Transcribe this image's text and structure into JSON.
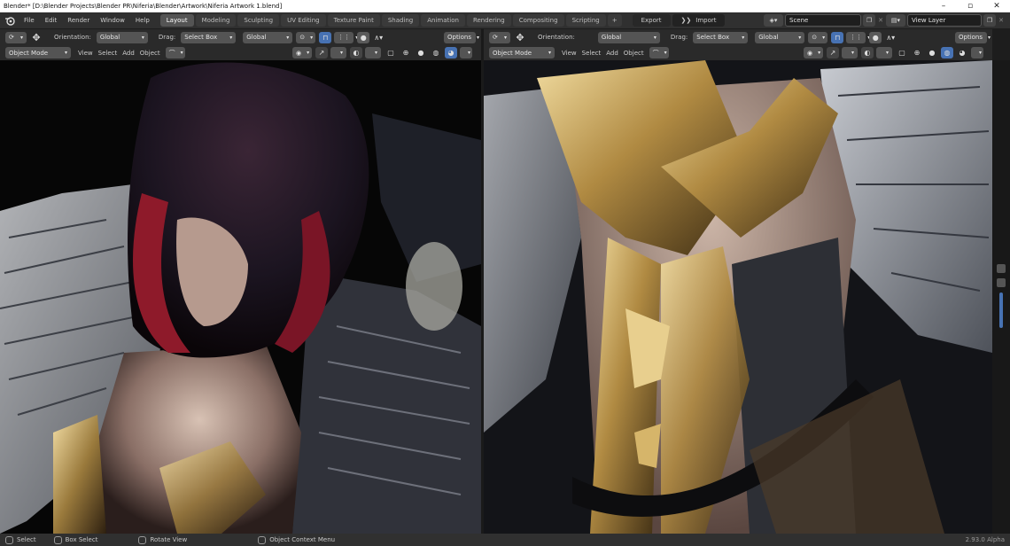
{
  "window": {
    "title": "Blender* [D:\\Blender Projects\\Blender PR\\Niferia\\Blender\\Artwork\\Niferia Artwork 1.blend]",
    "minimize": "–",
    "maximize": "▫",
    "close": "✕"
  },
  "menu": [
    "File",
    "Edit",
    "Render",
    "Window",
    "Help"
  ],
  "workspace_tabs": [
    {
      "label": "Layout",
      "active": true
    },
    {
      "label": "Modeling"
    },
    {
      "label": "Sculpting"
    },
    {
      "label": "UV Editing"
    },
    {
      "label": "Texture Paint"
    },
    {
      "label": "Shading"
    },
    {
      "label": "Animation"
    },
    {
      "label": "Rendering"
    },
    {
      "label": "Compositing"
    },
    {
      "label": "Scripting"
    }
  ],
  "add_tab": "+",
  "export_label": "Export",
  "import_label": "Import",
  "scene": {
    "value": "Scene"
  },
  "view_layer": {
    "value": "View Layer"
  },
  "left_header": {
    "orientation_label": "Orientation:",
    "orientation_value": "Global",
    "drag_label": "Drag:",
    "drag_value": "Select Box",
    "pivot_value": "Global",
    "options_label": "Options"
  },
  "right_header": {
    "orientation_label": "Orientation:",
    "orientation_value": "Global",
    "drag_label": "Drag:",
    "drag_value": "Select Box",
    "pivot_value": "Global",
    "options_label": "Options"
  },
  "left_mode": {
    "mode": "Object Mode",
    "view": "View",
    "select": "Select",
    "add": "Add",
    "object": "Object"
  },
  "right_mode": {
    "mode": "Object Mode",
    "view": "View",
    "select": "Select",
    "add": "Add",
    "object": "Object"
  },
  "status": {
    "select": "Select",
    "box_select": "Box Select",
    "rotate_view": "Rotate View",
    "context_menu": "Object Context Menu",
    "version": "2.93.0 Alpha"
  },
  "colors": {
    "accent": "#4772b3",
    "header": "#2a2a2a",
    "topbar": "#303030"
  }
}
